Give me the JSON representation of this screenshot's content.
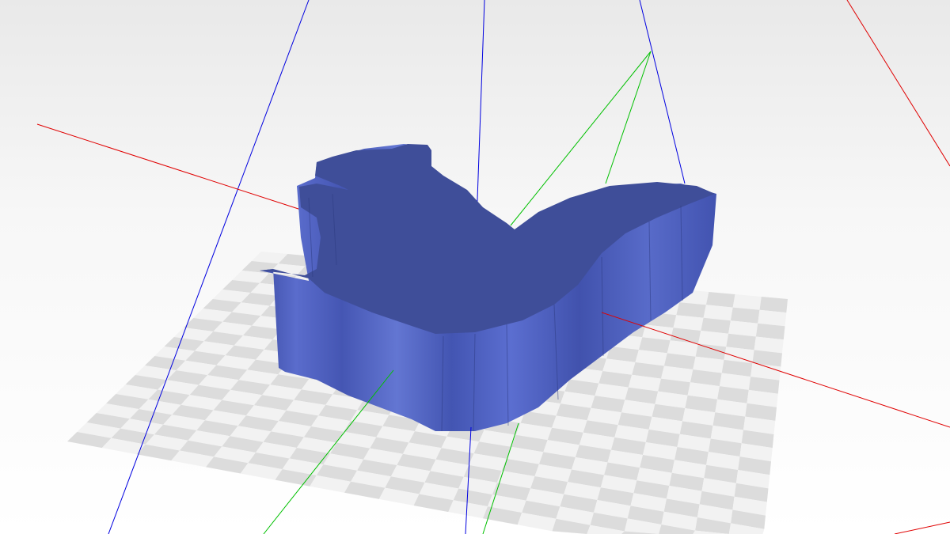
{
  "viewport": {
    "view": "3d-perspective",
    "background_top": "#e9e9e9",
    "background_bottom": "#ffffff"
  },
  "build_plate": {
    "icon": "checkerboard-build-plate",
    "light_color": "#f2f2f2",
    "dark_color": "#dcdcdc",
    "cells": 20
  },
  "model": {
    "icon": "squirrel-model",
    "top_color": "#3f4e99",
    "side_color": "#4b5cb9",
    "side_highlight": "#6274d0"
  },
  "axes": {
    "x_color": "#e00000",
    "y_color": "#00c000",
    "z_color": "#0000e0"
  }
}
